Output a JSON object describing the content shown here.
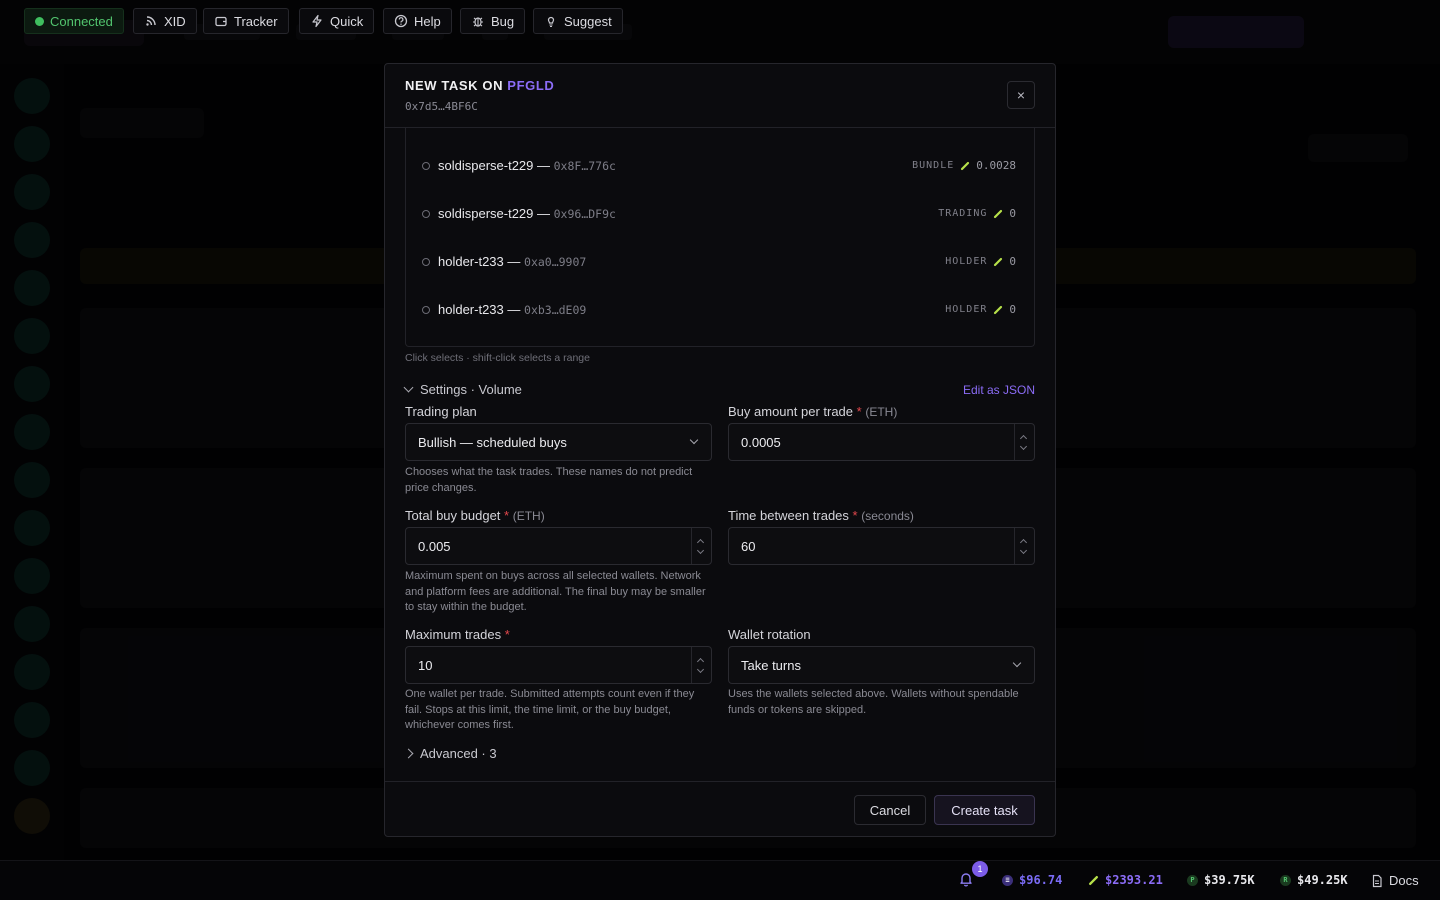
{
  "modal": {
    "title_prefix": "NEW TASK ON",
    "token": "PFGLD",
    "address": "0x7d5…4BF6C",
    "close_label": "×"
  },
  "wallets": [
    {
      "name": "soldisperse-t229 —",
      "address": "0x8F…776c",
      "role": "BUNDLE",
      "balance": "0.0028"
    },
    {
      "name": "soldisperse-t229 —",
      "address": "0x96…DF9c",
      "role": "TRADING",
      "balance": "0"
    },
    {
      "name": "holder-t233 —",
      "address": "0xa0…9907",
      "role": "HOLDER",
      "balance": "0"
    },
    {
      "name": "holder-t233 —",
      "address": "0xb3…dE09",
      "role": "HOLDER",
      "balance": "0"
    }
  ],
  "hint": "Click selects · shift-click selects a range",
  "settings": {
    "section_label": "Settings · Volume",
    "edit_json": "Edit as JSON",
    "trading_plan": {
      "label": "Trading plan",
      "value": "Bullish — scheduled buys",
      "help": "Chooses what the task trades. These names do not predict price changes."
    },
    "buy_amount": {
      "label": "Buy amount per trade",
      "unit": "(ETH)",
      "value": "0.0005"
    },
    "total_budget": {
      "label": "Total buy budget",
      "unit": "(ETH)",
      "value": "0.005",
      "help": "Maximum spent on buys across all selected wallets. Network and platform fees are additional. The final buy may be smaller to stay within the budget."
    },
    "time_between": {
      "label": "Time between trades",
      "unit": "(seconds)",
      "value": "60"
    },
    "max_trades": {
      "label": "Maximum trades",
      "value": "10",
      "help": "One wallet per trade. Submitted attempts count even if they fail. Stops at this limit, the time limit, or the buy budget, whichever comes first."
    },
    "wallet_rotation": {
      "label": "Wallet rotation",
      "value": "Take turns",
      "help": "Uses the wallets selected above. Wallets without spendable funds or tokens are skipped."
    },
    "required_mark": "*"
  },
  "advanced": {
    "label": "Advanced · 3"
  },
  "footer": {
    "cancel": "Cancel",
    "create": "Create task"
  },
  "statusbar": {
    "connected": "Connected",
    "xid": "XID",
    "tracker": "Tracker",
    "quick": "Quick",
    "help": "Help",
    "bug": "Bug",
    "suggest": "Suggest",
    "notifications": "1",
    "prices": [
      {
        "value": "$96.74",
        "color": "#7b6cf6",
        "glyph": "≡"
      },
      {
        "value": "$2393.21",
        "color": "#8b6cf6",
        "glyph": "⬧"
      },
      {
        "value": "$39.75K",
        "color": "#e8e8ec",
        "glyph": "P"
      },
      {
        "value": "$49.25K",
        "color": "#e8e8ec",
        "glyph": "R"
      }
    ],
    "docs": "Docs"
  },
  "colors": {
    "accent": "#8b6cf6",
    "required": "#e5484d",
    "connected": "#52c46e",
    "eth_green": "#b7e14a"
  }
}
